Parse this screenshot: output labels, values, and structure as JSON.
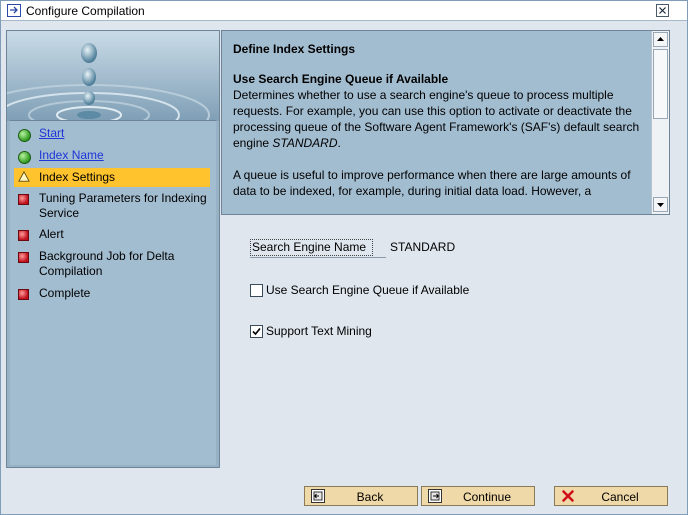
{
  "window": {
    "title": "Configure Compilation"
  },
  "roadmap": {
    "steps": [
      {
        "label": "Start",
        "status": "done",
        "link": true
      },
      {
        "label": "Index Name",
        "status": "done",
        "link": true
      },
      {
        "label": "Index Settings",
        "status": "current",
        "link": false
      },
      {
        "label": "Tuning Parameters for Indexing Service",
        "status": "pending",
        "link": false
      },
      {
        "label": "Alert",
        "status": "pending",
        "link": false
      },
      {
        "label": "Background Job for Delta Compilation",
        "status": "pending",
        "link": false
      },
      {
        "label": "Complete",
        "status": "pending",
        "link": false
      }
    ]
  },
  "info": {
    "heading": "Define Index Settings",
    "subheading": "Use Search Engine Queue if Available",
    "paragraph1_a": "Determines whether to use a search engine's queue to process multiple requests. For example, you can use this option to activate or deactivate the processing queue of the Software Agent Framework's (SAF's) default search engine ",
    "paragraph1_em": "STANDARD",
    "paragraph1_b": ".",
    "paragraph2": "A queue is useful to improve performance when there are large amounts of data to be indexed, for example, during initial data load. However, a"
  },
  "form": {
    "search_engine_label": "Search Engine Name",
    "search_engine_value": "STANDARD",
    "queue_checkbox_label": "Use Search Engine Queue if Available",
    "queue_checked": false,
    "text_mining_label": "Support Text Mining",
    "text_mining_checked": true
  },
  "buttons": {
    "back": "Back",
    "continue": "Continue",
    "cancel": "Cancel"
  },
  "colors": {
    "active_step": "#ffc32e",
    "panel_bg": "#a3bdd0",
    "button_bg": "#f0d9a8",
    "link": "#1e35d8"
  }
}
